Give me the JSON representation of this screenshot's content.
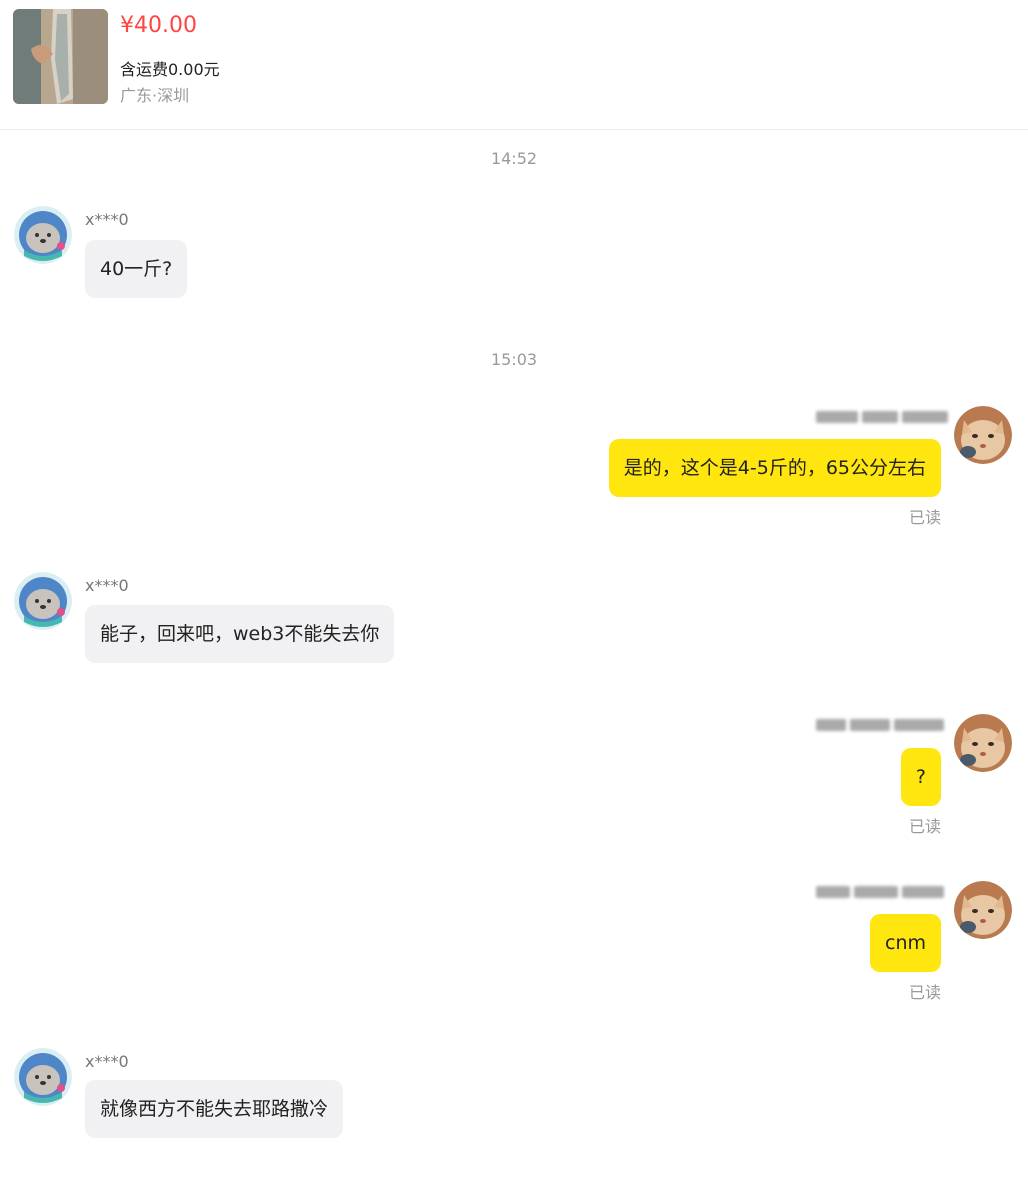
{
  "product": {
    "price": "¥40.00",
    "shipping": "含运费0.00元",
    "location": "广东·深圳"
  },
  "timestamps": [
    "14:52",
    "15:03"
  ],
  "other_user": {
    "name": "x***0"
  },
  "messages": [
    {
      "from": "other",
      "text": "40一斤?"
    },
    {
      "from": "me",
      "text": "是的，这个是4-5斤的，65公分左右",
      "status": "已读"
    },
    {
      "from": "other",
      "text": "能子，回来吧，web3不能失去你"
    },
    {
      "from": "me",
      "text": "?",
      "status": "已读"
    },
    {
      "from": "me",
      "text": "cnm",
      "status": "已读"
    },
    {
      "from": "other",
      "text": "就像西方不能失去耶路撒冷"
    }
  ],
  "colors": {
    "price": "#ff4444",
    "outgoing_bubble": "#ffe60f",
    "incoming_bubble": "#f1f1f3"
  }
}
